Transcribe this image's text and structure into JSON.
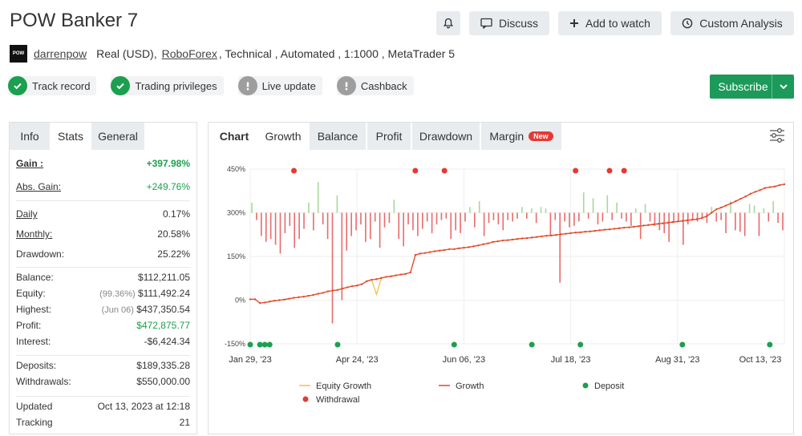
{
  "header": {
    "title": "POW Banker 7",
    "buttons": {
      "discuss": "Discuss",
      "watch": "Add to watch",
      "analysis": "Custom Analysis"
    }
  },
  "account": {
    "logo_text": "POW",
    "user": "darrenpow",
    "type_before": "Real (USD),",
    "broker": "RoboForex",
    "type_after": ", Technical , Automated , 1:1000 , MetaTrader 5"
  },
  "badges": [
    {
      "label": "Track record",
      "icon": "check-icon",
      "color": "#1aa04f"
    },
    {
      "label": "Trading privileges",
      "icon": "check-icon",
      "color": "#1aa04f"
    },
    {
      "label": "Live update",
      "icon": "exclamation-icon",
      "color": "#9e9e9e"
    },
    {
      "label": "Cashback",
      "icon": "exclamation-icon",
      "color": "#9e9e9e"
    }
  ],
  "subscribe": {
    "label": "Subscribe",
    "color": "#1b9a59"
  },
  "left_tabs": [
    "Info",
    "Stats",
    "General"
  ],
  "stats": {
    "gain_label": "Gain :",
    "gain": "+397.98%",
    "abs_gain_label": "Abs. Gain:",
    "abs_gain": "+249.76%",
    "daily_label": "Daily",
    "daily": "0.17%",
    "monthly_label": "Monthly:",
    "monthly": "20.58%",
    "drawdown_label": "Drawdown:",
    "drawdown": "25.22%",
    "balance_label": "Balance:",
    "balance": "$112,211.05",
    "equity_label": "Equity:",
    "equity_pct": "(99.36%)",
    "equity": "$111,492.24",
    "highest_label": "Highest:",
    "highest_date": "(Jun 06)",
    "highest": "$437,350.54",
    "profit_label": "Profit:",
    "profit": "$472,875.77",
    "interest_label": "Interest:",
    "interest": "-$6,424.34",
    "deposits_label": "Deposits:",
    "deposits": "$189,335.28",
    "withdrawals_label": "Withdrawals:",
    "withdrawals": "$550,000.00",
    "updated_label": "Updated",
    "updated": "Oct 13, 2023 at 12:18",
    "tracking_label": "Tracking",
    "tracking": "21"
  },
  "chart_tabs": {
    "chart": "Chart",
    "growth": "Growth",
    "balance": "Balance",
    "profit": "Profit",
    "drawdown": "Drawdown",
    "margin": "Margin",
    "new_badge": "New"
  },
  "chart_data": {
    "type": "line",
    "x_ticks": [
      "Jan 29, '23",
      "Apr 24, '23",
      "Jun 06, '23",
      "Jul 18, '23",
      "Aug 31, '23",
      "Oct 13, '23"
    ],
    "y_ticks": [
      "450%",
      "300%",
      "150%",
      "0%",
      "-150%"
    ],
    "ylim": [
      -150,
      450
    ],
    "growth": [
      3,
      3,
      -10,
      -8,
      -5,
      -2,
      0,
      2,
      5,
      8,
      10,
      12,
      15,
      18,
      22,
      25,
      30,
      33,
      35,
      40,
      44,
      48,
      50,
      55,
      65,
      70,
      72,
      76,
      80,
      82,
      85,
      88,
      90,
      95,
      155,
      160,
      162,
      165,
      168,
      170,
      172,
      175,
      175,
      178,
      180,
      182,
      185,
      188,
      192,
      195,
      200,
      202,
      205,
      206,
      208,
      210,
      212,
      213,
      215,
      217,
      219,
      221,
      222,
      224,
      226,
      228,
      230,
      232,
      233,
      235,
      236,
      238,
      240,
      242,
      243,
      245,
      247,
      249,
      250,
      252,
      254,
      256,
      258,
      260,
      262,
      264,
      266,
      268,
      270,
      272,
      274,
      276,
      278,
      282,
      288,
      300,
      312,
      318,
      325,
      332,
      340,
      348,
      356,
      365,
      372,
      378,
      385,
      388,
      390,
      395,
      398
    ],
    "equity_dip": {
      "index": 26,
      "value": 20
    },
    "daily_bars": [
      35,
      -25,
      -80,
      -100,
      -90,
      -110,
      -140,
      -70,
      -45,
      -120,
      -90,
      -55,
      35,
      -60,
      105,
      -40,
      -90,
      -380,
      60,
      -300,
      -130,
      -80,
      -60,
      -40,
      -100,
      -90,
      -30,
      -120,
      -50,
      -35,
      45,
      -90,
      -115,
      -40,
      -60,
      -80,
      -55,
      -30,
      -70,
      -40,
      -25,
      -20,
      -90,
      -60,
      -70,
      -30,
      20,
      -50,
      40,
      -80,
      -35,
      -25,
      -40,
      -60,
      -25,
      -30,
      -20,
      20,
      -20,
      15,
      -35,
      20,
      15,
      -80,
      -25,
      -240,
      -30,
      -50,
      -45,
      -30,
      70,
      -20,
      50,
      -40,
      -30,
      60,
      -25,
      35,
      -20,
      -30,
      -45,
      15,
      -90,
      30,
      -30,
      -45,
      -60,
      -70,
      -100,
      -35,
      -30,
      -110,
      -40,
      -25,
      -30,
      -20,
      -35,
      20,
      -30,
      -25,
      -70,
      40,
      -60,
      -65,
      -80,
      30,
      25,
      -80,
      15,
      -30,
      40,
      -35,
      -60
    ],
    "withdrawals_idx": [
      9,
      34,
      40,
      67,
      74,
      77
    ],
    "deposits_idx": [
      0,
      2,
      3,
      4,
      18,
      42,
      58,
      68,
      89,
      107
    ],
    "legend": {
      "equity": "Equity Growth",
      "growth": "Growth",
      "deposit": "Deposit",
      "withdrawal": "Withdrawal"
    },
    "colors": {
      "growth": "#e0482f",
      "equity": "#f2c14e",
      "pos_bar": "#a8d89a",
      "neg_bar": "#e86b6b",
      "deposit": "#1aa04f",
      "withdrawal": "#e53935"
    }
  }
}
